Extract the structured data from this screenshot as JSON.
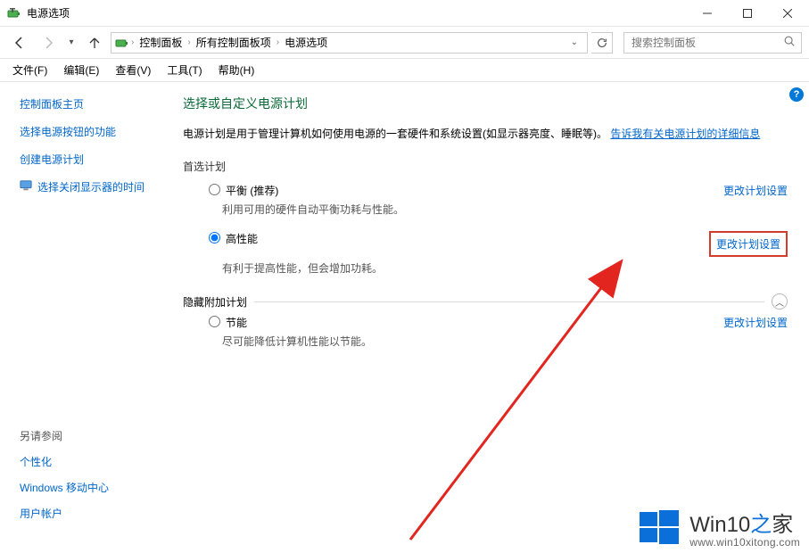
{
  "window": {
    "title": "电源选项",
    "min_label": "最小化",
    "max_label": "最大化",
    "close_label": "关闭"
  },
  "nav": {
    "crumb1": "控制面板",
    "crumb2": "所有控制面板项",
    "crumb3": "电源选项",
    "search_placeholder": "搜索控制面板"
  },
  "menu": {
    "file": "文件(F)",
    "edit": "编辑(E)",
    "view": "查看(V)",
    "tools": "工具(T)",
    "help": "帮助(H)"
  },
  "sidebar": {
    "home": "控制面板主页",
    "links": [
      "选择电源按钮的功能",
      "创建电源计划",
      "选择关闭显示器的时间"
    ],
    "see_also_head": "另请参阅",
    "see_also": [
      "个性化",
      "Windows 移动中心",
      "用户帐户"
    ]
  },
  "content": {
    "heading": "选择或自定义电源计划",
    "desc_prefix": "电源计划是用于管理计算机如何使用电源的一套硬件和系统设置(如显示器亮度、睡眠等)。",
    "desc_link": "告诉我有关电源计划的详细信息",
    "preferred_head": "首选计划",
    "hidden_head": "隐藏附加计划",
    "plans": {
      "balanced": {
        "name": "平衡 (推荐)",
        "desc": "利用可用的硬件自动平衡功耗与性能。",
        "change": "更改计划设置"
      },
      "high": {
        "name": "高性能",
        "desc": "有利于提高性能，但会增加功耗。",
        "change": "更改计划设置"
      },
      "saver": {
        "name": "节能",
        "desc": "尽可能降低计算机性能以节能。",
        "change": "更改计划设置"
      }
    }
  },
  "watermark": {
    "brand_a": "Win10",
    "brand_b": "之",
    "brand_c": "家",
    "url": "www.win10xitong.com"
  }
}
